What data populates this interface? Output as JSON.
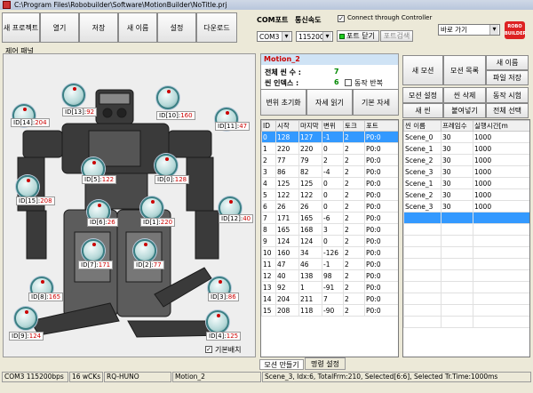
{
  "window": {
    "title": "C:\\Program Files\\Robobuilder\\Software\\MotionBuilder\\NoTitle.prj"
  },
  "toolbar": {
    "buttons": [
      "새 프로젝트",
      "열기",
      "저장",
      "새 이름",
      "설정",
      "다운로드"
    ]
  },
  "com": {
    "port_label": "COM포트",
    "speed_label": "통신속도",
    "port_value": "COM3",
    "speed_value": "115200",
    "connect_label": "Connect through Controller",
    "port_close": "포트 닫기",
    "port_scan": "포트검색",
    "goto_value": "바로 가기",
    "logo": "ROBO BUILDER"
  },
  "control_panel": {
    "title": "제어 패널",
    "basic_pose_label": "기본배치",
    "servos": [
      {
        "id": "ID[14]:",
        "val": "204"
      },
      {
        "id": "ID[13]:",
        "val": "92"
      },
      {
        "id": "ID[10]:",
        "val": "160"
      },
      {
        "id": "ID[11]:",
        "val": "47"
      },
      {
        "id": "ID[5]:",
        "val": "122"
      },
      {
        "id": "ID[0]:",
        "val": "128"
      },
      {
        "id": "ID[15]:",
        "val": "208"
      },
      {
        "id": "ID[6]:",
        "val": "26"
      },
      {
        "id": "ID[1]:",
        "val": "220"
      },
      {
        "id": "ID[12]:",
        "val": "40"
      },
      {
        "id": "ID[7]:",
        "val": "171"
      },
      {
        "id": "ID[2]:",
        "val": "77"
      },
      {
        "id": "ID[8]:",
        "val": "165"
      },
      {
        "id": "ID[3]:",
        "val": "86"
      },
      {
        "id": "ID[9]:",
        "val": "124"
      },
      {
        "id": "ID[4]:",
        "val": "125"
      }
    ]
  },
  "motion": {
    "name": "Motion_2",
    "total_scenes_label": "전체 씬 수 :",
    "total_scenes": "7",
    "scene_index_label": "씬 인덱스 :",
    "scene_index": "6",
    "repeat_label": "동작 반복",
    "btn_init": "변위 초기화",
    "btn_read": "자세 읽기",
    "btn_basic": "기본 자세"
  },
  "right_buttons": [
    "새 모션",
    "모션 목록",
    "새 이름",
    "파일 저장",
    "모션 설정",
    "씬 삭제",
    "동작 시험",
    "새 씬",
    "붙여넣기",
    "전체 선택"
  ],
  "servo_table": {
    "headers": [
      "ID",
      "시작",
      "마지막",
      "변위",
      "토크",
      "포트"
    ],
    "rows": [
      [
        "0",
        "128",
        "127",
        "-1",
        "2",
        "P0:0"
      ],
      [
        "1",
        "220",
        "220",
        "0",
        "2",
        "P0:0"
      ],
      [
        "2",
        "77",
        "79",
        "2",
        "2",
        "P0:0"
      ],
      [
        "3",
        "86",
        "82",
        "-4",
        "2",
        "P0:0"
      ],
      [
        "4",
        "125",
        "125",
        "0",
        "2",
        "P0:0"
      ],
      [
        "5",
        "122",
        "122",
        "0",
        "2",
        "P0:0"
      ],
      [
        "6",
        "26",
        "26",
        "0",
        "2",
        "P0:0"
      ],
      [
        "7",
        "171",
        "165",
        "-6",
        "2",
        "P0:0"
      ],
      [
        "8",
        "165",
        "168",
        "3",
        "2",
        "P0:0"
      ],
      [
        "9",
        "124",
        "124",
        "0",
        "2",
        "P0:0"
      ],
      [
        "10",
        "160",
        "34",
        "-126",
        "2",
        "P0:0"
      ],
      [
        "11",
        "47",
        "46",
        "-1",
        "2",
        "P0:0"
      ],
      [
        "12",
        "40",
        "138",
        "98",
        "2",
        "P0:0"
      ],
      [
        "13",
        "92",
        "1",
        "-91",
        "2",
        "P0:0"
      ],
      [
        "14",
        "204",
        "211",
        "7",
        "2",
        "P0:0"
      ],
      [
        "15",
        "208",
        "118",
        "-90",
        "2",
        "P0:0"
      ]
    ]
  },
  "scene_table": {
    "headers": [
      "씬 이름",
      "프레임수",
      "실행시간[m"
    ],
    "rows": [
      [
        "Scene_0",
        "30",
        "1000"
      ],
      [
        "Scene_1",
        "30",
        "1000"
      ],
      [
        "Scene_2",
        "30",
        "1000"
      ],
      [
        "Scene_3",
        "30",
        "1000"
      ],
      [
        "Scene_1",
        "30",
        "1000"
      ],
      [
        "Scene_2",
        "30",
        "1000"
      ],
      [
        "Scene_3",
        "30",
        "1000"
      ]
    ]
  },
  "tabs": [
    "모션 만들기",
    "명령 설정"
  ],
  "status": {
    "port": "COM3 115200bps",
    "wck": "16 wCKs",
    "robot": "RQ-HUNO",
    "motion": "Motion_2",
    "detail": "Scene_3, Idx:6, TotalFrm:210, Selected[6:6], Selected Tr.Time:1000ms"
  }
}
